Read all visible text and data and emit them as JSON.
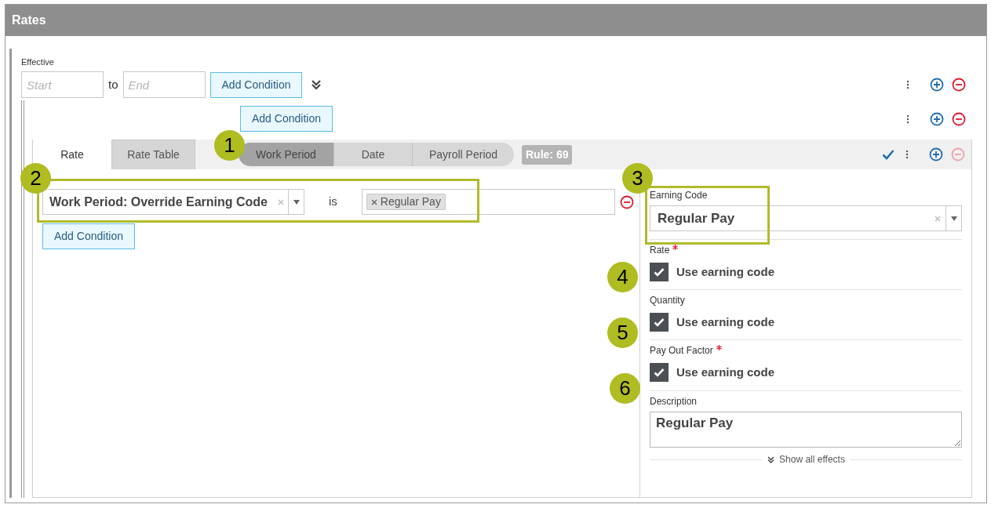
{
  "header": {
    "title": "Rates"
  },
  "effective": {
    "label": "Effective",
    "start": {
      "placeholder": "Start"
    },
    "separator": "to",
    "end": {
      "placeholder": "End"
    },
    "add_condition": "Add Condition"
  },
  "nested": {
    "add_condition": "Add Condition"
  },
  "tabs": [
    {
      "label": "Rate",
      "selected": true
    },
    {
      "label": "Rate Table",
      "selected": false
    }
  ],
  "period_toggle": [
    {
      "label": "Work Period",
      "selected": true
    },
    {
      "label": "Date",
      "selected": false
    },
    {
      "label": "Payroll Period",
      "selected": false
    }
  ],
  "rule_badge": "Rule: 69",
  "rule_actions": {
    "remove_disabled": true
  },
  "condition": {
    "field": "Work Period: Override Earning Code",
    "operator": "is",
    "values": [
      "Regular Pay"
    ],
    "add_condition": "Add Condition"
  },
  "effects": {
    "earning_code": {
      "label": "Earning Code",
      "value": "Regular Pay"
    },
    "items": [
      {
        "label": "Rate",
        "required": true,
        "checkbox_label": "Use earning code",
        "checked": true
      },
      {
        "label": "Quantity",
        "required": false,
        "checkbox_label": "Use earning code",
        "checked": true
      },
      {
        "label": "Pay Out Factor",
        "required": true,
        "checkbox_label": "Use earning code",
        "checked": true
      }
    ],
    "description": {
      "label": "Description",
      "value": "Regular Pay"
    },
    "show_all": "Show all effects"
  },
  "callouts": [
    {
      "number": "1"
    },
    {
      "number": "2"
    },
    {
      "number": "3"
    },
    {
      "number": "4"
    },
    {
      "number": "5"
    },
    {
      "number": "6"
    }
  ]
}
